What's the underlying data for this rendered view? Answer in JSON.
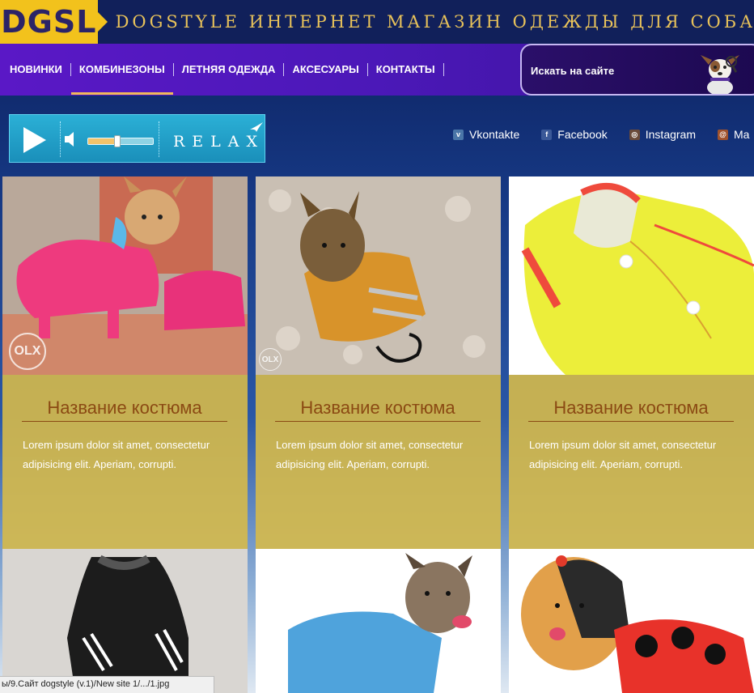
{
  "header": {
    "logo": "DGSL",
    "tagline": "DOGSTYLE ИНТЕРНЕТ МАГАЗИН ОДЕЖДЫ ДЛЯ СОБАК"
  },
  "nav": {
    "items": [
      {
        "label": "НОВИНКИ"
      },
      {
        "label": "КОМБИНЕЗОНЫ",
        "active": true
      },
      {
        "label": "ЛЕТНЯЯ ОДЕЖДА"
      },
      {
        "label": "АКСЕСУАРЫ"
      },
      {
        "label": "КОНТАКТЫ"
      }
    ],
    "search_label": "Искать на сайте"
  },
  "player": {
    "label": "RELAX",
    "volume": 0.45
  },
  "social": [
    {
      "label": "Vkontakte",
      "icon": "vk-icon",
      "color": "#4a76a8"
    },
    {
      "label": "Facebook",
      "icon": "facebook-icon",
      "color": "#3b5998"
    },
    {
      "label": "Instagram",
      "icon": "instagram-icon",
      "color": "#6a4a3a"
    },
    {
      "label": "Ma",
      "icon": "mail-icon",
      "color": "#a0522d"
    }
  ],
  "cards": [
    {
      "title": "Название костюма",
      "desc": "Lorem ipsum dolor sit amet, consectetur adipisicing elit. Aperiam, corrupti.",
      "watermark": "OLX"
    },
    {
      "title": "Название костюма",
      "desc": "Lorem ipsum dolor sit amet, consectetur adipisicing elit. Aperiam, corrupti.",
      "watermark": "OLX"
    },
    {
      "title": "Название костюма",
      "desc": "Lorem ipsum dolor sit amet, consectetur adipisicing elit. Aperiam, corrupti."
    }
  ],
  "status": {
    "url": "ы/9.Сайт dogstyle (v.1)/New site 1/.../1.jpg"
  },
  "colors": {
    "accent": "#f2c21c",
    "nav_bg": "#4b18b8",
    "card_info": "#d6ba4a",
    "card_title": "#8b4a13"
  }
}
